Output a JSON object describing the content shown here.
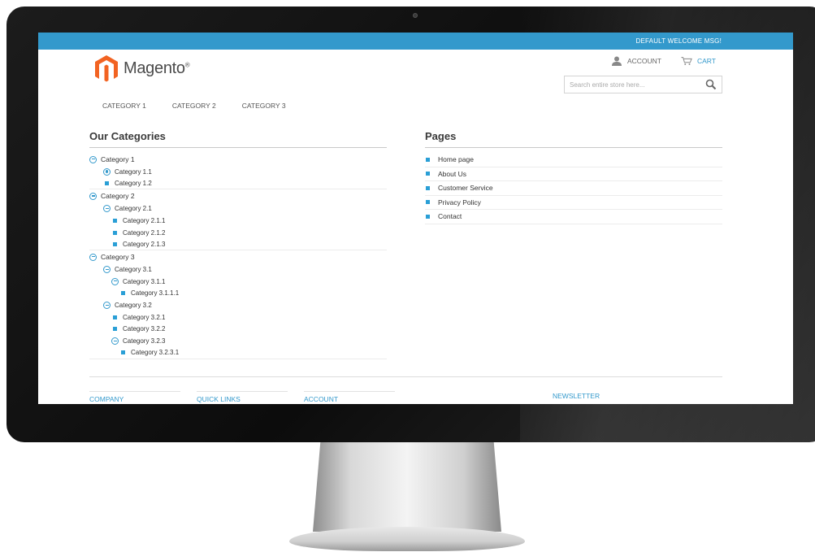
{
  "topbar": {
    "welcome": "DEFAULT WELCOME MSG!"
  },
  "logo": {
    "text": "Magento",
    "reg": "®"
  },
  "header": {
    "account_label": "ACCOUNT",
    "cart_label": "CART"
  },
  "search": {
    "placeholder": "Search entire store here..."
  },
  "nav": {
    "items": [
      "CATEGORY 1",
      "CATEGORY 2",
      "CATEGORY 3"
    ]
  },
  "categories": {
    "title": "Our Categories",
    "items": [
      {
        "label": "Category 1",
        "icon": "minus-circle-icon"
      },
      {
        "label": "Category 1.1",
        "icon": "dot-circle-icon"
      },
      {
        "label": "Category 1.2",
        "icon": "bullet-square-icon"
      },
      {
        "label": "Category 2",
        "icon": "minus-circle-icon"
      },
      {
        "label": "Category 2.1",
        "icon": "minus-circle-icon"
      },
      {
        "label": "Category 2.1.1",
        "icon": "bullet-square-icon"
      },
      {
        "label": "Category 2.1.2",
        "icon": "bullet-square-icon"
      },
      {
        "label": "Category 2.1.3",
        "icon": "bullet-square-icon"
      },
      {
        "label": "Category 3",
        "icon": "minus-circle-icon"
      },
      {
        "label": "Category 3.1",
        "icon": "minus-circle-icon"
      },
      {
        "label": "Category 3.1.1",
        "icon": "minus-circle-icon"
      },
      {
        "label": "Category 3.1.1.1",
        "icon": "bullet-square-icon"
      },
      {
        "label": "Category 3.2",
        "icon": "minus-circle-icon"
      },
      {
        "label": "Category 3.2.1",
        "icon": "bullet-square-icon"
      },
      {
        "label": "Category 3.2.2",
        "icon": "bullet-square-icon"
      },
      {
        "label": "Category 3.2.3",
        "icon": "minus-circle-icon"
      },
      {
        "label": "Category 3.2.3.1",
        "icon": "bullet-square-icon"
      }
    ]
  },
  "pages": {
    "title": "Pages",
    "items": [
      "Home page",
      "About Us",
      "Customer Service",
      "Privacy Policy",
      "Contact"
    ]
  },
  "footer": {
    "company": "COMPANY",
    "quick_links": "QUICK LINKS",
    "account": "ACCOUNT",
    "newsletter": "NEWSLETTER"
  },
  "colors": {
    "accent": "#3399cc",
    "logo_orange": "#f26322",
    "text": "#333333"
  }
}
